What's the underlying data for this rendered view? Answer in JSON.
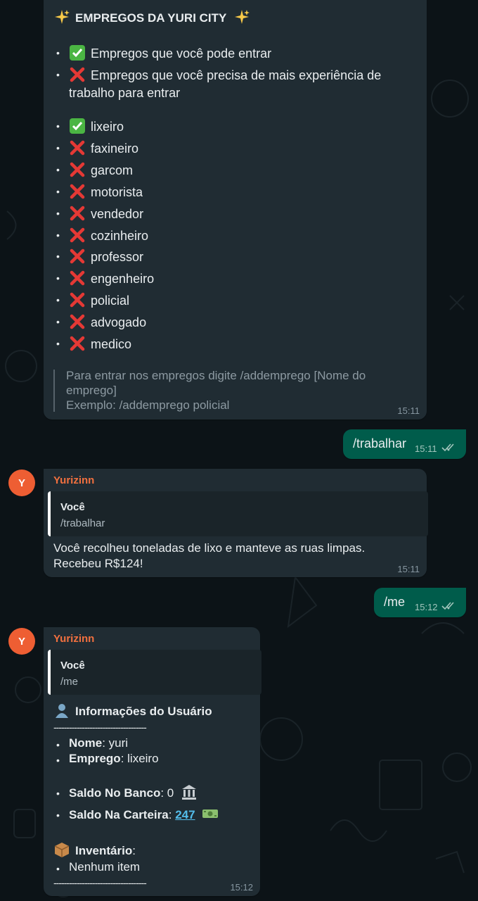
{
  "msg1": {
    "title": "EMPREGOS DA YURI CITY",
    "legend": [
      "Empregos que você pode entrar",
      "Empregos que você precisa de mais experiência de",
      "trabalho para entrar"
    ],
    "jobs": [
      "lixeiro",
      "faxineiro",
      "garcom",
      "motorista",
      "vendedor",
      "cozinheiro",
      "professor",
      "engenheiro",
      "policial",
      "advogado",
      "medico"
    ],
    "hint": [
      "Para entrar nos empregos digite /addemprego [Nome do",
      "emprego]",
      "Exemplo: /addemprego policial"
    ],
    "time": "15:11"
  },
  "msg2": {
    "text": "/trabalhar",
    "time": "15:11"
  },
  "msg3": {
    "sender": "Yurizinn",
    "avatar": "Y",
    "reply_name": "Você",
    "reply_text": "/trabalhar",
    "lines": [
      "Você recolheu toneladas de lixo e manteve as ruas limpas.",
      "Recebeu R$124!"
    ],
    "time": "15:11"
  },
  "msg4": {
    "text": "/me",
    "time": "15:12"
  },
  "msg5": {
    "sender": "Yurizinn",
    "avatar": "Y",
    "reply_name": "Você",
    "reply_text": "/me",
    "heading": "Informações do Usuário",
    "separator": "------------------------------------",
    "nome_label": "Nome",
    "nome_value": ": yuri",
    "emprego_label": "Emprego",
    "emprego_value": ": lixeiro",
    "banco_label": "Saldo No Banco",
    "banco_value": ": 0",
    "carteira_label": "Saldo Na Carteira",
    "carteira_sep": ": ",
    "carteira_value": "247",
    "inventario_label": "Inventário",
    "inventario_colon": ":",
    "inventario_item": "Nenhum item",
    "time": "15:12"
  },
  "colors": {
    "incoming": "#202c33",
    "outgoing": "#005c4b",
    "sender": "#f1703f",
    "avatar": "#ee5e33",
    "link": "#53bdeb"
  },
  "icons": [
    "sparkles-icon",
    "check-icon",
    "cross-icon",
    "person-icon",
    "bank-icon",
    "money-icon",
    "package-icon",
    "double-check-icon"
  ]
}
